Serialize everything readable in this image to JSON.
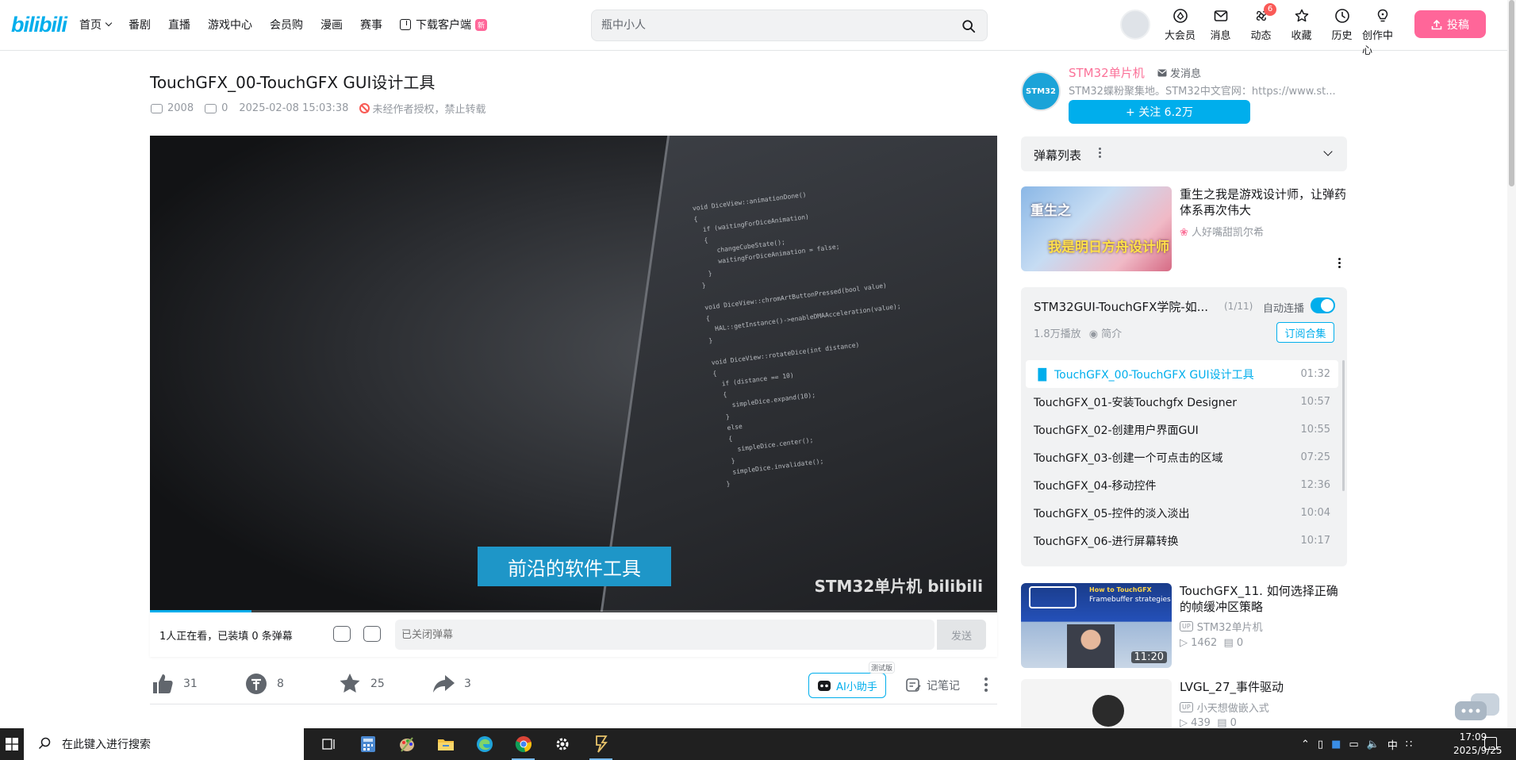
{
  "nav": {
    "logo": "bilibili",
    "items": [
      {
        "label": "首页",
        "has_dropdown": true
      },
      {
        "label": "番剧"
      },
      {
        "label": "直播"
      },
      {
        "label": "游戏中心"
      },
      {
        "label": "会员购"
      },
      {
        "label": "漫画"
      },
      {
        "label": "赛事"
      }
    ],
    "download_label": "下载客户端",
    "download_badge": "新",
    "search_placeholder": "瓶中小人",
    "right": [
      {
        "label": "大会员",
        "icon": "vip-icon"
      },
      {
        "label": "消息",
        "icon": "mail-icon"
      },
      {
        "label": "动态",
        "icon": "wind-icon",
        "badge": "6"
      },
      {
        "label": "收藏",
        "icon": "star-icon"
      },
      {
        "label": "历史",
        "icon": "clock-icon"
      },
      {
        "label": "创作中心",
        "icon": "bulb-icon"
      }
    ],
    "upload_label": "投稿"
  },
  "video": {
    "title": "TouchGFX_00-TouchGFX GUI设计工具",
    "views": "2008",
    "danmaku_count": "0",
    "date": "2025-02-08 15:03:38",
    "copyright": "未经作者授权，禁止转载",
    "caption": "前沿的软件工具",
    "watermark": "STM32单片机 bilibili",
    "progress": 0.12
  },
  "danmaku_bar": {
    "viewers": "1人正在看，已装填 0 条弹幕",
    "input_placeholder": "已关闭弹幕",
    "send_label": "发送"
  },
  "actions": {
    "like": "31",
    "coin": "8",
    "favorite": "25",
    "share": "3",
    "ai_label": "AI小助手",
    "ai_tag": "测试版",
    "note_label": "记笔记"
  },
  "uploader": {
    "name": "STM32单片机",
    "avatar_text": "STM32",
    "message_label": "发消息",
    "description": "STM32蝶粉聚集地。STM32中文官网：https://www.st...",
    "follow_label": "+ 关注 6.2万"
  },
  "danmaku_list_label": "弹幕列表",
  "ad": {
    "title": "重生之我是游戏设计师，让弹药体系再次伟大",
    "author": "人好嘴甜凯尔希",
    "thumb_text1": "重生之",
    "thumb_text2": "我是明日方舟设计师"
  },
  "playlist": {
    "title": "STM32GUI-TouchGFX学院-如...",
    "count": "(1/11)",
    "autoplay_label": "自动连播",
    "plays": "1.8万播放",
    "intro_label": "简介",
    "subscribe_label": "订阅合集",
    "episodes": [
      {
        "title": "TouchGFX_00-TouchGFX GUI设计工具",
        "duration": "01:32",
        "active": true
      },
      {
        "title": "TouchGFX_01-安装Touchgfx Designer",
        "duration": "10:57"
      },
      {
        "title": "TouchGFX_02-创建用户界面GUI",
        "duration": "10:55"
      },
      {
        "title": "TouchGFX_03-创建一个可点击的区域",
        "duration": "07:25"
      },
      {
        "title": "TouchGFX_04-移动控件",
        "duration": "12:36"
      },
      {
        "title": "TouchGFX_05-控件的淡入淡出",
        "duration": "10:04"
      },
      {
        "title": "TouchGFX_06-进行屏幕转换",
        "duration": "10:17"
      }
    ]
  },
  "recommendations": [
    {
      "title": "TouchGFX_11. 如何选择正确的帧缓冲区策略",
      "up": "STM32单片机",
      "views": "1462",
      "danmaku": "0",
      "duration": "11:20",
      "thumb_text": "How to TouchGFX",
      "thumb_sub": "Framebuffer strategies"
    },
    {
      "title": "LVGL_27_事件驱动",
      "up": "小天想做嵌入式",
      "views": "439",
      "danmaku": "0"
    }
  ],
  "taskbar": {
    "search_placeholder": "在此键入进行搜索",
    "time": "17:09",
    "date": "2025/9/25",
    "ime": "中"
  }
}
